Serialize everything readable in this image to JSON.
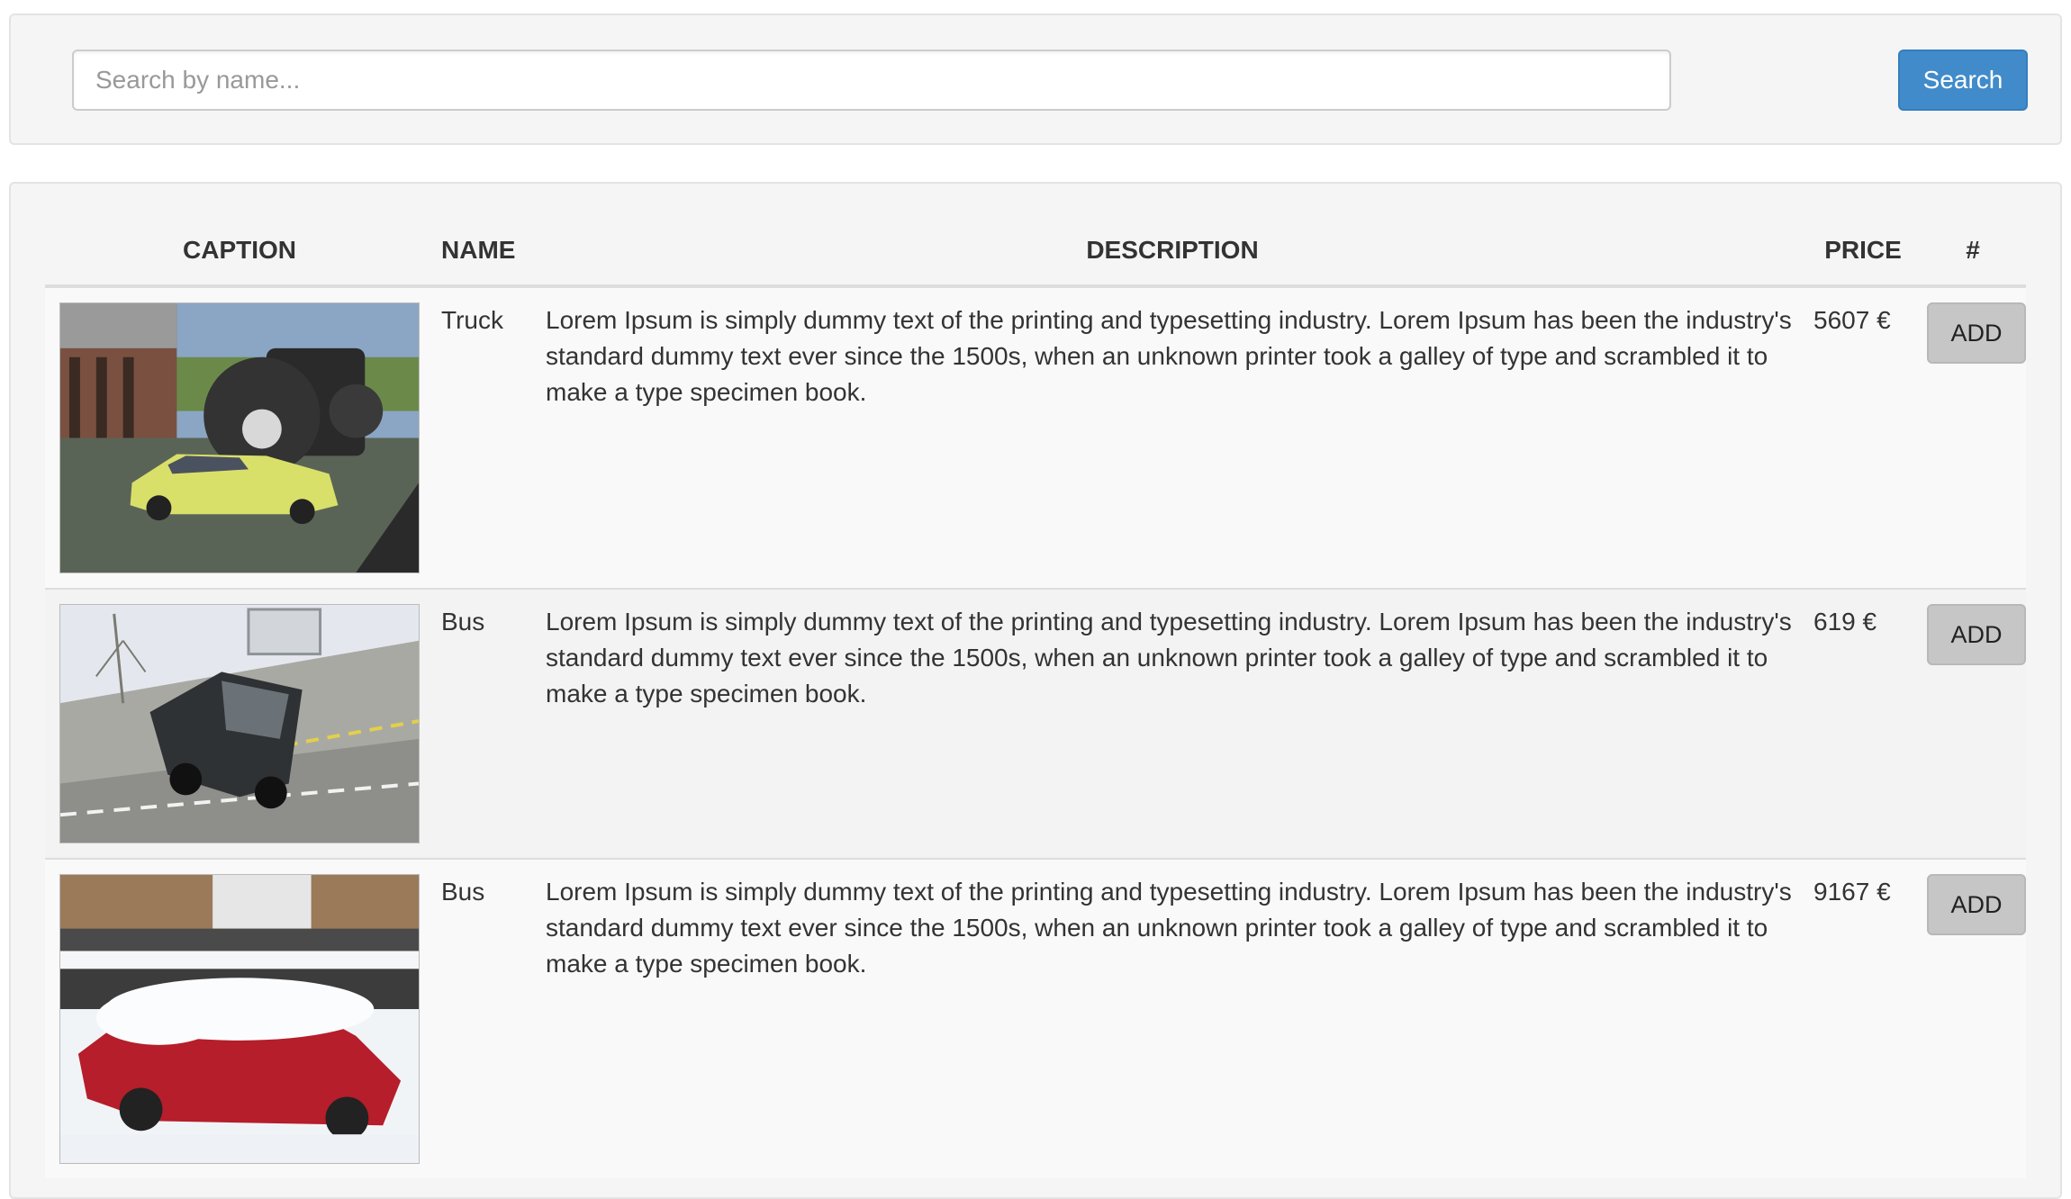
{
  "search": {
    "placeholder": "Search by name...",
    "value": "",
    "button_label": "Search"
  },
  "table": {
    "headers": {
      "caption": "CAPTION",
      "name": "NAME",
      "description": "DESCRIPTION",
      "price": "PRICE",
      "action": "#"
    },
    "rows": [
      {
        "image": "crushed-car-under-monster-truck",
        "name": "Truck",
        "description": "Lorem Ipsum is simply dummy text of the printing and typesetting industry. Lorem Ipsum has been the industry's standard dummy text ever since the 1500s, when an unknown printer took a galley of type and scrambled it to make a type specimen book.",
        "price": "5607 €",
        "action_label": "ADD"
      },
      {
        "image": "van-on-banked-curve",
        "name": "Bus",
        "description": "Lorem Ipsum is simply dummy text of the printing and typesetting industry. Lorem Ipsum has been the industry's standard dummy text ever since the 1500s, when an unknown printer took a galley of type and scrambled it to make a type specimen book.",
        "price": "619 €",
        "action_label": "ADD"
      },
      {
        "image": "red-convertible-in-snow",
        "name": "Bus",
        "description": "Lorem Ipsum is simply dummy text of the printing and typesetting industry. Lorem Ipsum has been the industry's standard dummy text ever since the 1500s, when an unknown printer took a galley of type and scrambled it to make a type specimen book.",
        "price": "9167 €",
        "action_label": "ADD"
      }
    ]
  },
  "colors": {
    "primary": "#428bca",
    "panel_bg": "#f5f5f5",
    "add_button_bg": "#c6c6c6"
  }
}
